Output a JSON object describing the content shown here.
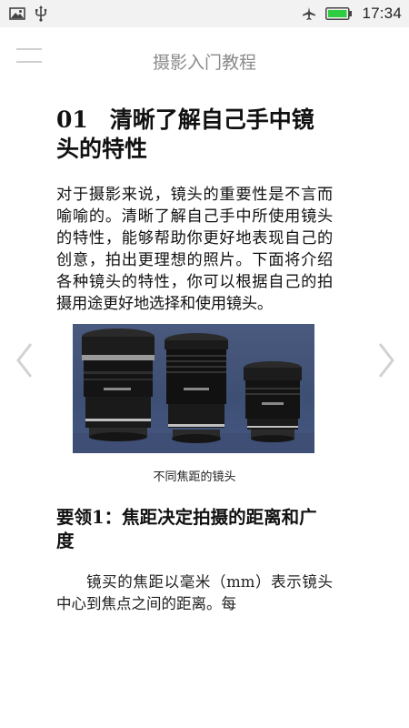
{
  "status_bar": {
    "time": "17:34",
    "left_icons": [
      "image-icon",
      "usb-icon"
    ],
    "right_icons": [
      "airplane-mode-icon",
      "battery-icon"
    ],
    "battery_color": "#2ecc40"
  },
  "app_bar": {
    "title": "摄影入门教程",
    "menu_icon": "menu-icon"
  },
  "article": {
    "chapter_number": "01",
    "chapter_title": "清晰了解自己手中镜头的特性",
    "intro": "对于摄影来说，镜头的重要性是不言而喻喻的。清晰了解自己手中所使用镜头的特性，能够帮助你更好地表现自己的创意，拍出更理想的照片。下面将介绍各种镜头的特性，你可以根据自己的拍摄用途更好地选择和使用镜头。",
    "image_caption": "不同焦距的镜头",
    "section_heading": "要领1：焦距决定拍摄的距离和广度",
    "body": "镜买的焦距以毫米（mm）表示镜头中心到焦点之间的距离。每"
  },
  "navigation": {
    "prev_icon": "chevron-left-icon",
    "next_icon": "chevron-right-icon"
  }
}
